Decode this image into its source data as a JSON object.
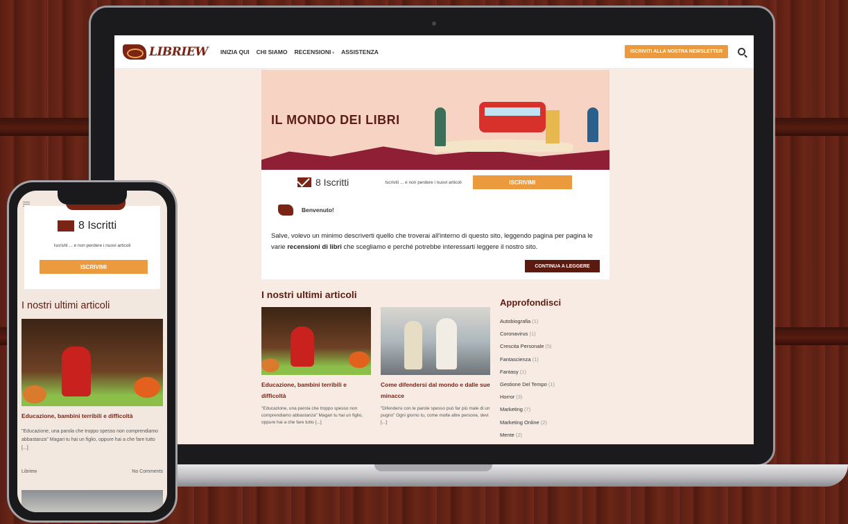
{
  "site": {
    "logo_text": "LIBRIEW",
    "nav": [
      "INIZIA QUI",
      "CHI SIAMO",
      "RECENSIONI",
      "ASSISTENZA"
    ],
    "nav_dropdown_index": 2,
    "newsletter_button": "ISCRIVITI ALLA NOSTRA NEWSLETTER",
    "search_icon": "search-icon"
  },
  "hero": {
    "title": "IL MONDO DEI LIBRI"
  },
  "subscribe": {
    "count": "8 Iscritti",
    "text": "Iscriviti ... e non perdere i nuovi articoli",
    "button": "ISCRIVIMI"
  },
  "welcome": {
    "title": "Benvenuto!",
    "text_before": "Salve, volevo un minimo descriverti quello che troverai all'interno di questo sito, leggendo pagina per pagina le varie ",
    "text_bold": "recensioni di libri",
    "text_after": " che scegliamo e perché potrebbe interessarti leggere il nostro sito.",
    "button": "CONTINUA A LEGGERE"
  },
  "articles": {
    "section_title": "I nostri ultimi articoli",
    "items": [
      {
        "title": "Educazione, bambini terribili e difficoltà",
        "excerpt": "\"Educazione, una parola che troppo spesso non comprendiamo abbastanza\" Magari tu hai un figlio, oppure hai a che fare tutto [...]"
      },
      {
        "title": "Come difendersi dal mondo e dalle sue minacce",
        "excerpt": "\"Difendersi con le parole spesso può far più male di un pugno\" Ogni giorno tu, come molte altre persone, devi [...]"
      }
    ]
  },
  "sidebar": {
    "title": "Approfondisci",
    "categories": [
      {
        "name": "Autobiografia",
        "count": "(1)"
      },
      {
        "name": "Coronavirus",
        "count": "(1)"
      },
      {
        "name": "Crescita Personale",
        "count": "(5)"
      },
      {
        "name": "Fantascienza",
        "count": "(1)"
      },
      {
        "name": "Fantasy",
        "count": "(1)"
      },
      {
        "name": "Gestione Del Tempo",
        "count": "(1)"
      },
      {
        "name": "Horror",
        "count": "(3)"
      },
      {
        "name": "Marketing",
        "count": "(7)"
      },
      {
        "name": "Marketing Online",
        "count": "(2)"
      },
      {
        "name": "Mente",
        "count": "(2)"
      }
    ]
  },
  "phone": {
    "subscribe_count": "8 Iscritti",
    "subscribe_text": "Iscriviti ... e non perdere i nuovi articoli",
    "subscribe_button": "ISCRIVIMI",
    "section_title": "I nostri ultimi articoli",
    "article_title": "Educazione, bambini terribili e difficoltà",
    "article_excerpt": "\"Educazione, una parola che troppo spesso non comprendiamo abbastanza\" Magari tu hai un figlio, oppure hai a che fare tutto [...]",
    "author": "Libriew",
    "comments": "No Comments"
  },
  "colors": {
    "accent_orange": "#eb9a3d",
    "brand_maroon": "#7a2416",
    "dark_button": "#5a1a10"
  }
}
